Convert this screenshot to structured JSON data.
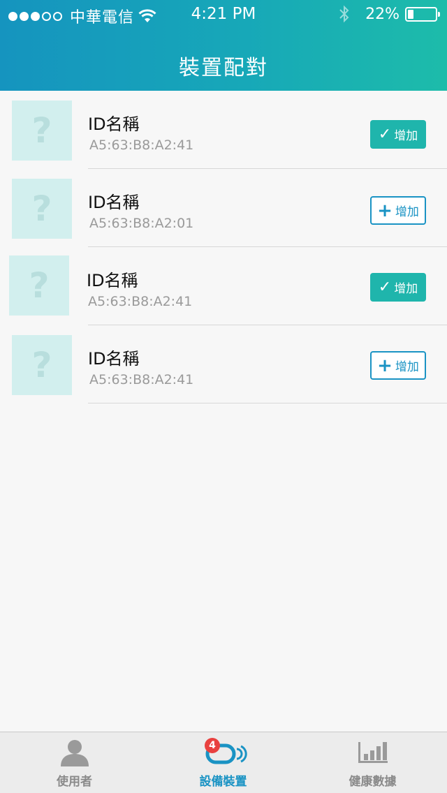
{
  "status_bar": {
    "carrier": "中華電信",
    "time": "4:21 PM",
    "battery_percent": "22%",
    "battery_level": 0.22,
    "signal_bars_filled": 3,
    "signal_bars_total": 5
  },
  "header": {
    "title": "裝置配對"
  },
  "devices": [
    {
      "name": "ID名稱",
      "mac": "A5:63:B8:A2:41",
      "added": true,
      "button_label": "增加",
      "thumb_icon": "?"
    },
    {
      "name": "ID名稱",
      "mac": "A5:63:B8:A2:01",
      "added": false,
      "button_label": "增加",
      "thumb_icon": "?"
    },
    {
      "name": "ID名稱",
      "mac": "A5:63:B8:A2:41",
      "added": true,
      "button_label": "增加",
      "thumb_icon": "?"
    },
    {
      "name": "ID名稱",
      "mac": "A5:63:B8:A2:41",
      "added": false,
      "button_label": "增加",
      "thumb_icon": "?"
    }
  ],
  "tabbar": {
    "tabs": [
      {
        "label": "使用者",
        "icon": "user-icon",
        "active": false
      },
      {
        "label": "設備裝置",
        "icon": "device-icon",
        "active": true,
        "badge": "4"
      },
      {
        "label": "健康數據",
        "icon": "chart-icon",
        "active": false
      }
    ]
  },
  "colors": {
    "header_start": "#1594bf",
    "header_end": "#1dbcaa",
    "accent_teal": "#1fb5ac",
    "accent_blue": "#1a93c4",
    "badge_red": "#e9413f"
  }
}
